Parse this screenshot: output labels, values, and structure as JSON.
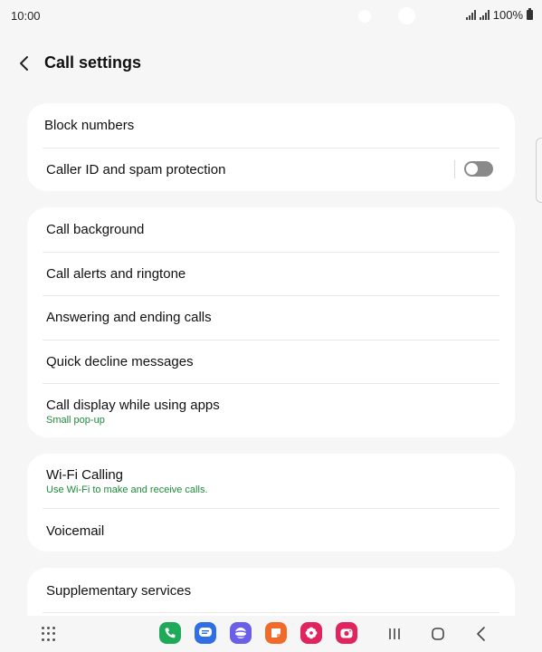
{
  "status_bar": {
    "time": "10:00",
    "battery": "100%"
  },
  "header": {
    "title": "Call settings"
  },
  "cards": [
    {
      "rows": [
        {
          "label": "Block numbers"
        },
        {
          "label": "Caller ID and spam protection",
          "toggle": false
        }
      ]
    },
    {
      "rows": [
        {
          "label": "Call background"
        },
        {
          "label": "Call alerts and ringtone"
        },
        {
          "label": "Answering and ending calls"
        },
        {
          "label": "Quick decline messages"
        },
        {
          "label": "Call display while using apps",
          "sublabel": "Small pop-up"
        }
      ]
    },
    {
      "rows": [
        {
          "label": "Wi-Fi Calling",
          "sublabel": "Use Wi-Fi to make and receive calls."
        },
        {
          "label": "Voicemail"
        }
      ]
    },
    {
      "rows": [
        {
          "label": "Supplementary services"
        }
      ]
    }
  ],
  "colors": {
    "accent_green": "#1f8a3b",
    "background": "#f6f6f6",
    "card": "#ffffff"
  },
  "dock": [
    {
      "icon": "phone-icon",
      "color": "#1faa59"
    },
    {
      "icon": "messages-icon",
      "color": "#2f6fe3"
    },
    {
      "icon": "internet-icon",
      "color": "#6a5fe8"
    },
    {
      "icon": "notes-icon",
      "color": "#f06a2b"
    },
    {
      "icon": "gallery-icon",
      "color": "#e0245e"
    },
    {
      "icon": "camera-icon",
      "color": "#e0245e"
    }
  ]
}
